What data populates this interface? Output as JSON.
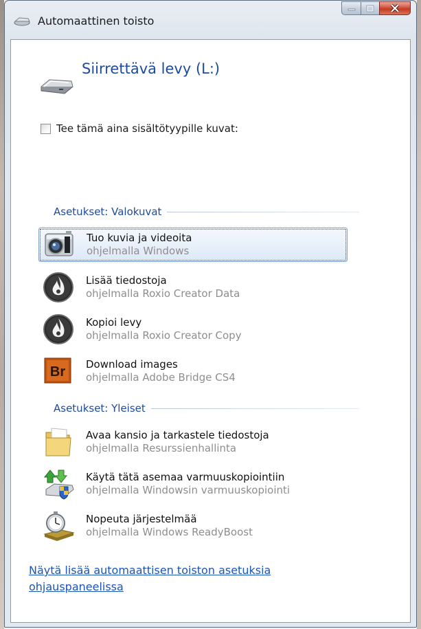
{
  "window": {
    "title": "Automaattinen toisto"
  },
  "device": {
    "title": "Siirrettävä levy (L:)",
    "icon": "removable-drive-icon"
  },
  "always_do": {
    "label": "Tee tämä aina sisältötyypille kuvat:",
    "checked": false
  },
  "groups": [
    {
      "header": "Asetukset: Valokuvat",
      "items": [
        {
          "title": "Tuo kuvia ja videoita",
          "subtitle": "ohjelmalla Windows",
          "icon": "camera-icon",
          "selected": true
        },
        {
          "title": "Lisää tiedostoja",
          "subtitle": "ohjelmalla Roxio Creator Data",
          "icon": "roxio-flame-icon",
          "selected": false
        },
        {
          "title": "Kopioi levy",
          "subtitle": "ohjelmalla Roxio Creator Copy",
          "icon": "roxio-flame-icon",
          "selected": false
        },
        {
          "title": "Download images",
          "subtitle": "ohjelmalla Adobe Bridge CS4",
          "icon": "adobe-bridge-icon",
          "icon_text": "Br",
          "selected": false
        }
      ]
    },
    {
      "header": "Asetukset: Yleiset",
      "items": [
        {
          "title": "Avaa kansio ja tarkastele tiedostoja",
          "subtitle": "ohjelmalla Resurssienhallinta",
          "icon": "folder-icon",
          "selected": false
        },
        {
          "title": "Käytä tätä asemaa varmuuskopiointiin",
          "subtitle": "ohjelmalla Windowsin varmuuskopiointi",
          "icon": "backup-icon",
          "selected": false
        },
        {
          "title": "Nopeuta järjestelmää",
          "subtitle": "ohjelmalla Windows ReadyBoost",
          "icon": "readyboost-icon",
          "selected": false
        }
      ]
    }
  ],
  "footer": {
    "link": "Näytä lisää automaattisen toiston asetuksia ohjauspaneelissa"
  },
  "colors": {
    "accent": "#1e4a9e",
    "link": "#1a55b8",
    "subtitle": "#8e8e8e",
    "close": "#c43a22"
  }
}
